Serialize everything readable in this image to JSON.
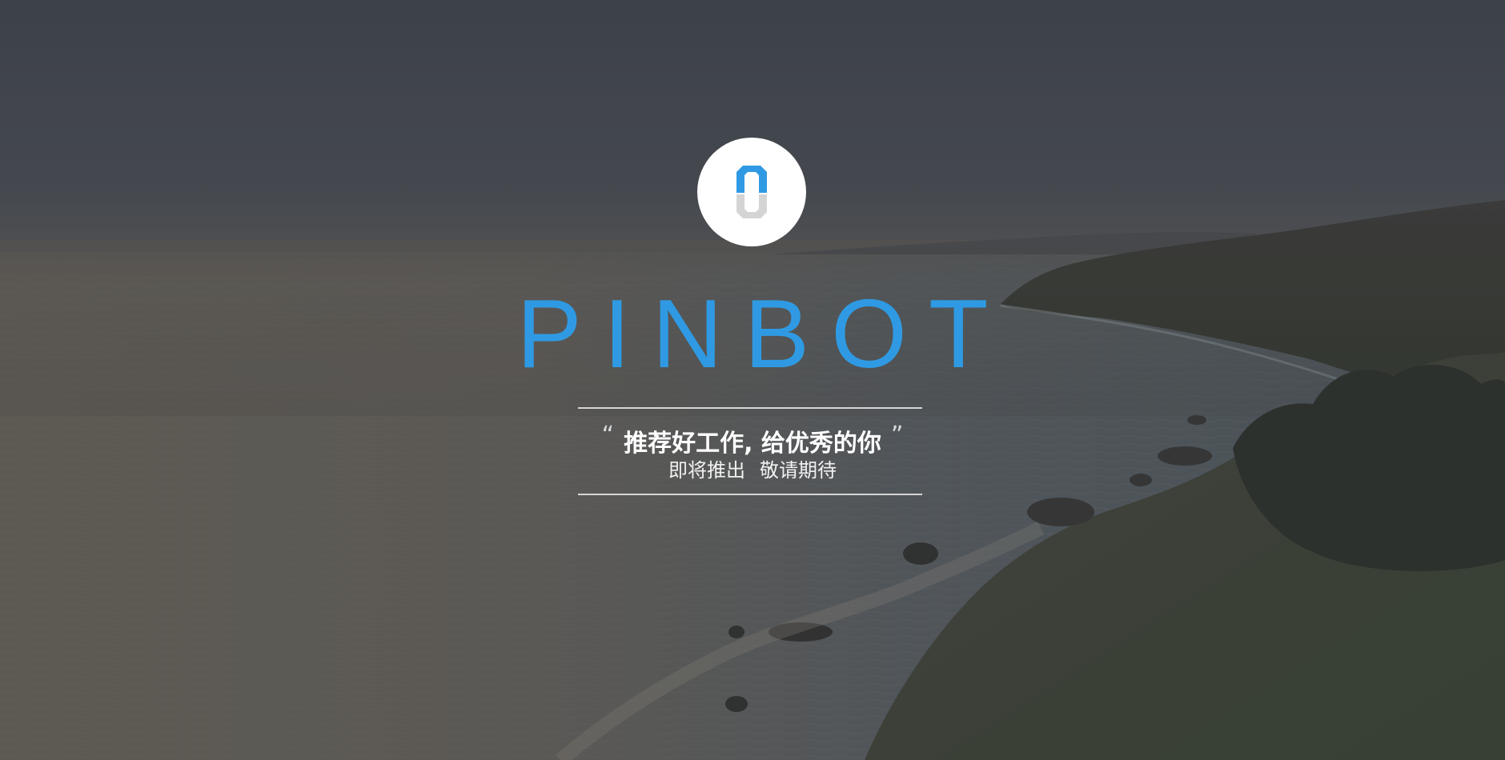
{
  "brand": {
    "name": "PINBOT",
    "color": "#2f9ae3",
    "logo_icon": "pinbot-logo-icon"
  },
  "tagline": {
    "open_quote": "“",
    "text": "推荐好工作, 给优秀的你",
    "close_quote": "”"
  },
  "notice": {
    "part1": "即将推出",
    "part2": "敬请期待"
  },
  "background": {
    "subject": "coastal-seascape-photo"
  }
}
